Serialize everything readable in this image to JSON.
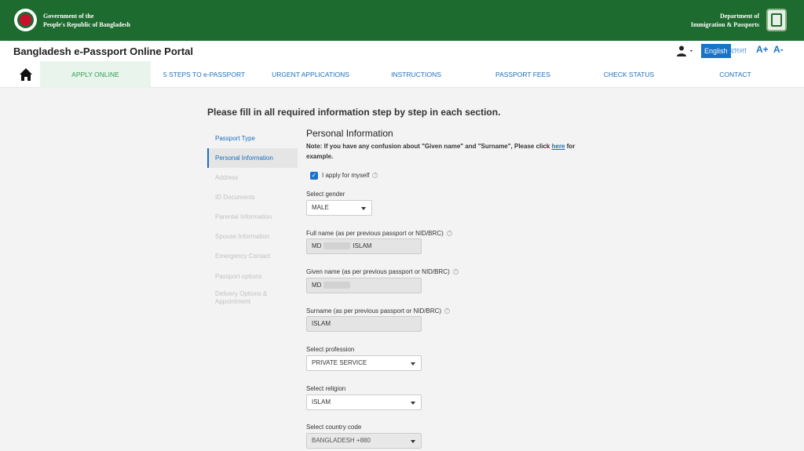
{
  "header": {
    "gov_line1": "Government of the",
    "gov_line2": "People's Republic of Bangladesh",
    "dept_line1": "Department of",
    "dept_line2": "Immigration & Passports",
    "left_emblem_icon": "bangladesh-government-seal",
    "right_emblem_icon": "dip-logo"
  },
  "portal": {
    "title": "Bangladesh e-Passport Online Portal",
    "lang_english": "English",
    "lang_bangla": "বাংলা",
    "font_increase": "A+",
    "font_decrease": "A-"
  },
  "nav": {
    "items": [
      {
        "label": "APPLY ONLINE",
        "active": true
      },
      {
        "label": "5 STEPS TO e-PASSPORT"
      },
      {
        "label": "URGENT APPLICATIONS"
      },
      {
        "label": "INSTRUCTIONS"
      },
      {
        "label": "PASSPORT FEES"
      },
      {
        "label": "CHECK STATUS"
      },
      {
        "label": "CONTACT"
      }
    ]
  },
  "form": {
    "instruction": "Please fill in all required information step by step in each section.",
    "steps": [
      "Passport Type",
      "Personal Information",
      "Address",
      "ID Documents",
      "Parental Information",
      "Spouse Information",
      "Emergency Contact",
      "Passport options",
      "Delivery Options & Appointment"
    ],
    "section_title": "Personal Information",
    "note_text": "Note: If you have any confusion about \"Given name\" and \"Surname\", Please click",
    "note_link": "here",
    "note_suffix": "for example.",
    "apply_myself_label": "I apply for myself",
    "gender_label": "Select gender",
    "gender_value": "MALE",
    "fullname_label": "Full name (as per previous passport or NID/BRC)",
    "fullname_first": "MD",
    "fullname_last": "ISLAM",
    "given_label": "Given name (as per previous passport or NID/BRC)",
    "given_value": "MD",
    "surname_label": "Surname (as per previous passport or NID/BRC)",
    "surname_value": "ISLAM",
    "profession_label": "Select profession",
    "profession_value": "PRIVATE SERVICE",
    "religion_label": "Select religion",
    "religion_value": "ISLAM",
    "country_label": "Select country code",
    "country_value": "BANGLADESH +880"
  }
}
